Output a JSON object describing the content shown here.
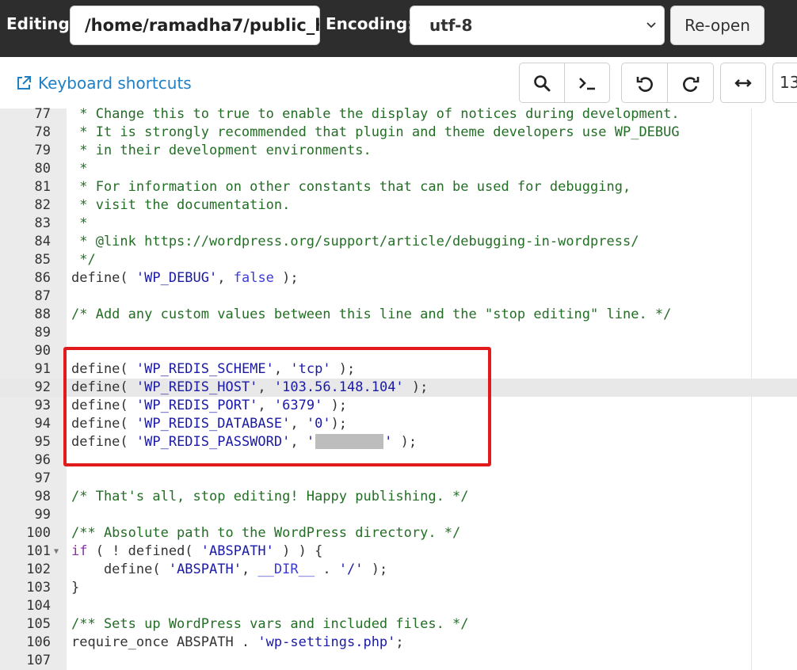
{
  "topbar": {
    "editing_label": "Editing:",
    "path_value": "/home/ramadha7/public_h",
    "encoding_label": "Encoding:",
    "encoding_value": "utf-8",
    "reopen_label": "Re-open"
  },
  "toolbar": {
    "keyboard_shortcuts": "Keyboard shortcuts",
    "zoom_value": "13"
  },
  "colors": {
    "topbar_bg": "#2d2d2d",
    "link": "#1f7fc4",
    "highlight": "#e11b1b",
    "comment": "#236e25",
    "string": "#1a1aa6",
    "keyword": "#3b3bd6"
  },
  "editor": {
    "active_line": 92,
    "lines": [
      {
        "n": "77",
        "code": " * Change this to true to enable the display of notices during development."
      },
      {
        "n": "78",
        "code": " * It is strongly recommended that plugin and theme developers use WP_DEBUG"
      },
      {
        "n": "79",
        "code": " * in their development environments."
      },
      {
        "n": "80",
        "code": " *"
      },
      {
        "n": "81",
        "code": " * For information on other constants that can be used for debugging,"
      },
      {
        "n": "82",
        "code": " * visit the documentation."
      },
      {
        "n": "83",
        "code": " *"
      },
      {
        "n": "84",
        "code": " * @link https://wordpress.org/support/article/debugging-in-wordpress/"
      },
      {
        "n": "85",
        "code": " */"
      },
      {
        "n": "86",
        "code": "define( 'WP_DEBUG', false );"
      },
      {
        "n": "87",
        "code": ""
      },
      {
        "n": "88",
        "code": "/* Add any custom values between this line and the \"stop editing\" line. */"
      },
      {
        "n": "89",
        "code": ""
      },
      {
        "n": "90",
        "code": ""
      },
      {
        "n": "91",
        "code": "define( 'WP_REDIS_SCHEME', 'tcp' );"
      },
      {
        "n": "92",
        "code": "define( 'WP_REDIS_HOST', '103.56.148.104' );"
      },
      {
        "n": "93",
        "code": "define( 'WP_REDIS_PORT', '6379' );"
      },
      {
        "n": "94",
        "code": "define( 'WP_REDIS_DATABASE', '0');"
      },
      {
        "n": "95",
        "code": "define( 'WP_REDIS_PASSWORD', '' );"
      },
      {
        "n": "96",
        "code": ""
      },
      {
        "n": "97",
        "code": ""
      },
      {
        "n": "98",
        "code": "/* That's all, stop editing! Happy publishing. */"
      },
      {
        "n": "99",
        "code": ""
      },
      {
        "n": "100",
        "code": "/** Absolute path to the WordPress directory. */"
      },
      {
        "n": "101",
        "code": "if ( ! defined( 'ABSPATH' ) ) {"
      },
      {
        "n": "102",
        "code": "    define( 'ABSPATH', __DIR__ . '/' );"
      },
      {
        "n": "103",
        "code": "}"
      },
      {
        "n": "104",
        "code": ""
      },
      {
        "n": "105",
        "code": "/** Sets up WordPress vars and included files. */"
      },
      {
        "n": "106",
        "code": "require_once ABSPATH . 'wp-settings.php';"
      },
      {
        "n": "107",
        "code": ""
      }
    ]
  }
}
